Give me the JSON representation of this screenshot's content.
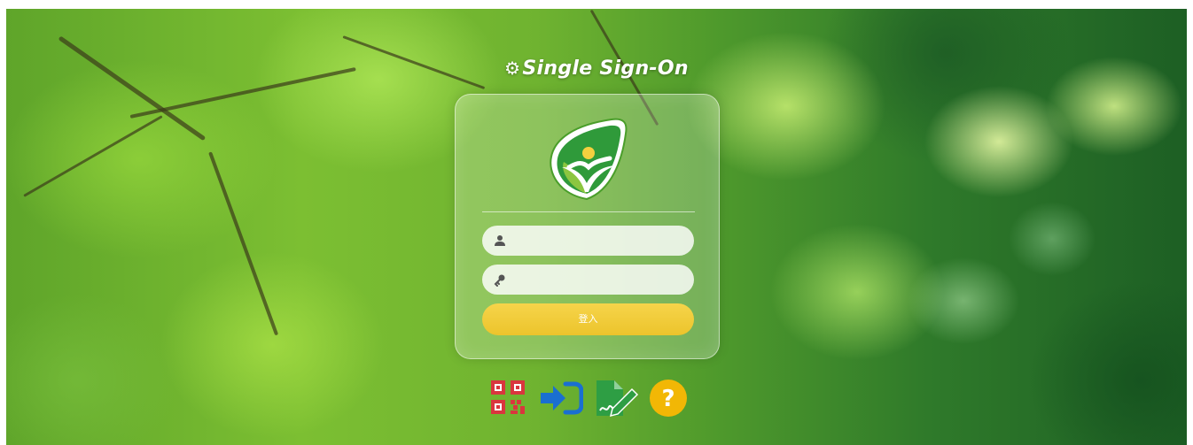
{
  "app": {
    "title": "Single Sign-On"
  },
  "form": {
    "username": {
      "value": "",
      "placeholder": ""
    },
    "password": {
      "value": "",
      "placeholder": ""
    },
    "login_label": "登入"
  },
  "toolbar": {
    "icons": [
      "qr-code-icon",
      "sign-in-icon",
      "signature-icon",
      "help-icon"
    ],
    "help_glyph": "?"
  },
  "colors": {
    "login_button": "#ecc42c",
    "qr_icon": "#d9363e",
    "sign_in_icon": "#1a6fd1",
    "signature_icon": "#2e9e44",
    "help_icon": "#f2b705"
  }
}
